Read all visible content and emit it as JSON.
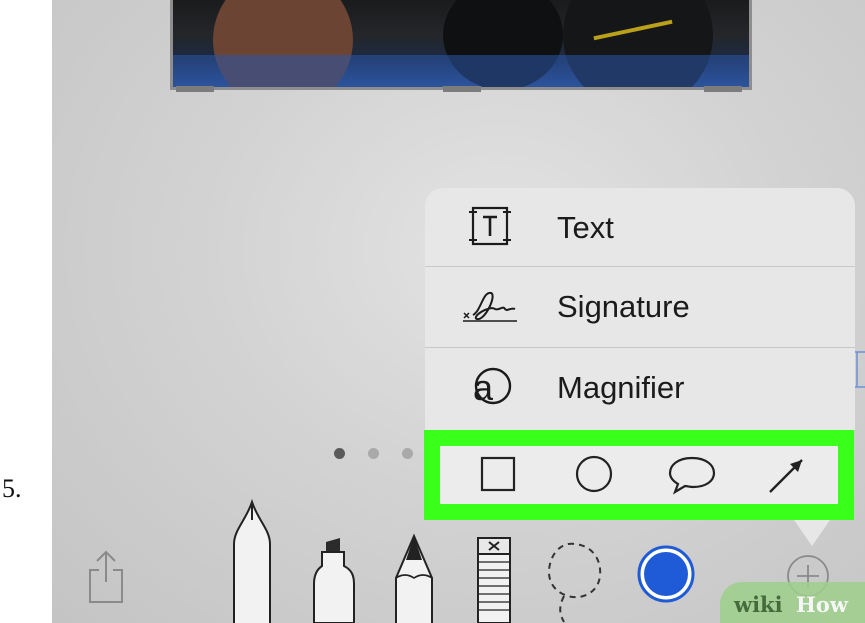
{
  "step_number": "5.",
  "menu": {
    "items": [
      {
        "label": "Text",
        "icon": "text-box-icon"
      },
      {
        "label": "Signature",
        "icon": "signature-icon"
      },
      {
        "label": "Magnifier",
        "icon": "magnifier-icon"
      }
    ]
  },
  "shapes": [
    "square-shape-icon",
    "circle-shape-icon",
    "speech-bubble-shape-icon",
    "arrow-shape-icon"
  ],
  "page_indicator": {
    "count": 3,
    "active": 0
  },
  "toolbar": [
    "share-icon",
    "pen-icon",
    "highlighter-icon",
    "pencil-icon",
    "eraser-icon",
    "lasso-icon",
    "color-picker-icon",
    "add-icon"
  ],
  "highlight_color": "#39ff1a",
  "selected_color": "#1f5bd6",
  "watermark": {
    "wiki": "wiki",
    "how": "How"
  }
}
